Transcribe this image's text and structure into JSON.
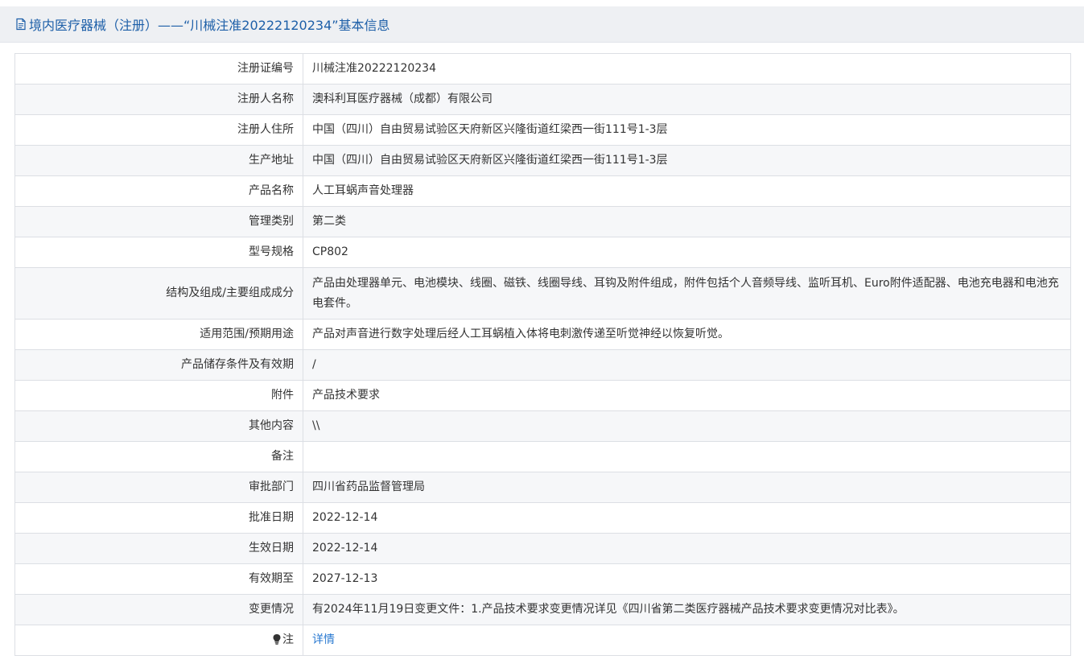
{
  "header": {
    "icon": "document-icon",
    "title": "境内医疗器械（注册）——“川械注准20222120234”基本信息"
  },
  "rows": [
    {
      "label": "注册证编号",
      "value": "川械注准20222120234"
    },
    {
      "label": "注册人名称",
      "value": "澳科利耳医疗器械（成都）有限公司"
    },
    {
      "label": "注册人住所",
      "value": "中国（四川）自由贸易试验区天府新区兴隆街道红梁西一街111号1-3层"
    },
    {
      "label": "生产地址",
      "value": "中国（四川）自由贸易试验区天府新区兴隆街道红梁西一街111号1-3层"
    },
    {
      "label": "产品名称",
      "value": "人工耳蜗声音处理器"
    },
    {
      "label": "管理类别",
      "value": "第二类"
    },
    {
      "label": "型号规格",
      "value": "CP802"
    },
    {
      "label": "结构及组成/主要组成成分",
      "value": "产品由处理器单元、电池模块、线圈、磁铁、线圈导线、耳钩及附件组成，附件包括个人音频导线、监听耳机、Euro附件适配器、电池充电器和电池充电套件。"
    },
    {
      "label": "适用范围/预期用途",
      "value": "产品对声音进行数字处理后经人工耳蜗植入体将电刺激传递至听觉神经以恢复听觉。"
    },
    {
      "label": "产品储存条件及有效期",
      "value": "/"
    },
    {
      "label": "附件",
      "value": "产品技术要求"
    },
    {
      "label": "其他内容",
      "value": "\\\\"
    },
    {
      "label": "备注",
      "value": ""
    },
    {
      "label": "审批部门",
      "value": "四川省药品监督管理局"
    },
    {
      "label": "批准日期",
      "value": "2022-12-14"
    },
    {
      "label": "生效日期",
      "value": "2022-12-14"
    },
    {
      "label": "有效期至",
      "value": "2027-12-13"
    },
    {
      "label": "变更情况",
      "value": "有2024年11月19日变更文件：1.产品技术要求变更情况详见《四川省第二类医疗器械产品技术要求变更情况对比表》。"
    }
  ],
  "note": {
    "icon": "lightbulb-icon",
    "label": "注",
    "link_text": "详情"
  },
  "colors": {
    "header_bg": "#eef0f3",
    "title": "#1d5fa8",
    "link": "#2a7ad1",
    "row_alt_bg": "#f6f7f9",
    "border": "#dcdfe4"
  }
}
